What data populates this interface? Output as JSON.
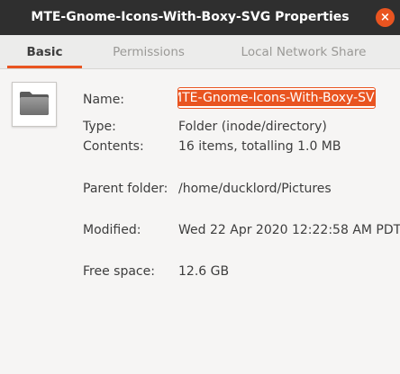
{
  "window": {
    "title": "MTE-Gnome-Icons-With-Boxy-SVG Properties",
    "close_glyph": "×"
  },
  "tabs": [
    {
      "label": "Basic",
      "active": true
    },
    {
      "label": "Permissions",
      "active": false
    },
    {
      "label": "Local Network Share",
      "active": false
    }
  ],
  "icons": {
    "folder": "folder-icon",
    "close": "close-icon"
  },
  "colors": {
    "accent": "#e95420",
    "titlebar": "#2f2f2f",
    "text": "#3d3d3d",
    "inactive_tab": "#9a9996"
  },
  "properties": {
    "name_label": "Name:",
    "name_value": "MTE-Gnome-Icons-With-Boxy-SVG",
    "type_label": "Type:",
    "type_value": "Folder (inode/directory)",
    "contents_label": "Contents:",
    "contents_value": "16 items, totalling 1.0 MB",
    "parent_label": "Parent folder:",
    "parent_value": "/home/ducklord/Pictures",
    "modified_label": "Modified:",
    "modified_value": "Wed 22 Apr 2020 12:22:58 AM PDT",
    "free_label": "Free space:",
    "free_value": "12.6 GB"
  }
}
